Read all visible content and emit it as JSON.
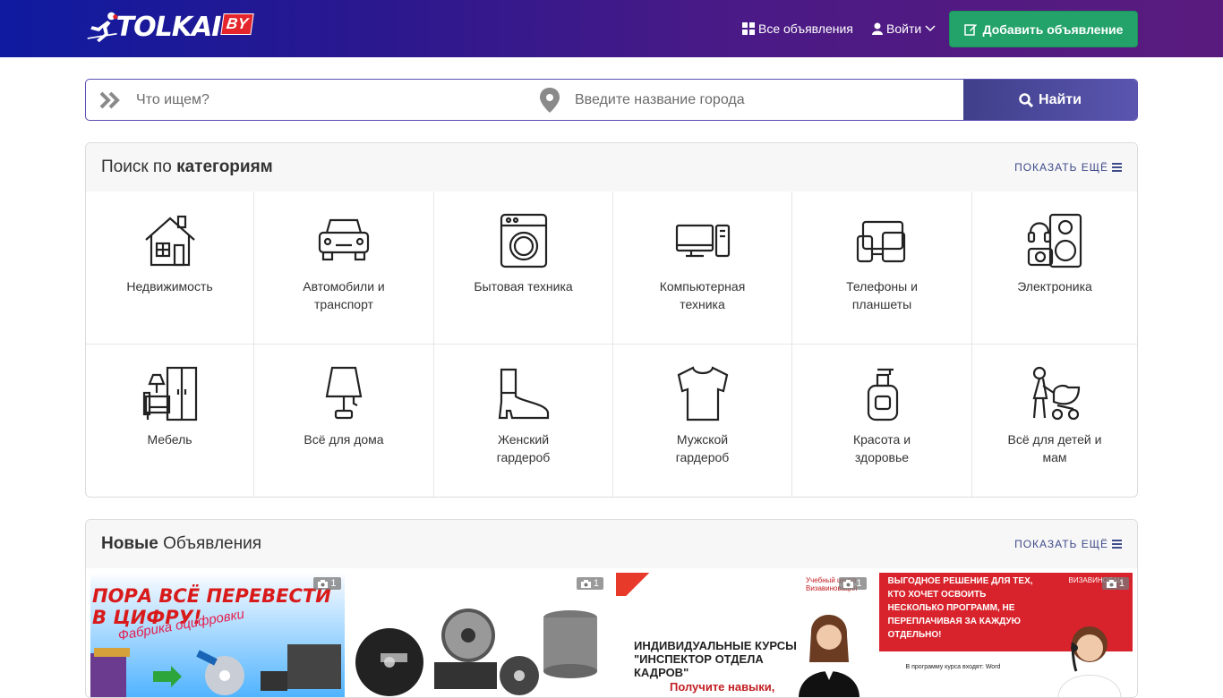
{
  "header": {
    "logo_text": "TOLKAI",
    "logo_suffix": "BY",
    "nav_all": "Все объявления",
    "nav_login": "Войти",
    "add_button": "Добавить объявление"
  },
  "search": {
    "query_placeholder": "Что ищем?",
    "city_placeholder": "Введите название города",
    "button": "Найти"
  },
  "categories": {
    "title_prefix": "Поиск по",
    "title_bold": "категориям",
    "show_more": "ПОКАЗАТЬ ЕЩЁ",
    "items": [
      {
        "label": "Недвижимость",
        "icon": "house-icon"
      },
      {
        "label": "Автомобили и транспорт",
        "icon": "car-icon"
      },
      {
        "label": "Бытовая техника",
        "icon": "washing-machine-icon"
      },
      {
        "label": "Компьютерная техника",
        "icon": "computer-icon"
      },
      {
        "label": "Телефоны и планшеты",
        "icon": "phone-tablet-icon"
      },
      {
        "label": "Электроника",
        "icon": "electronics-icon"
      },
      {
        "label": "Мебель",
        "icon": "furniture-icon"
      },
      {
        "label": "Всё для дома",
        "icon": "lamp-icon"
      },
      {
        "label": "Женский гардероб",
        "icon": "boot-icon"
      },
      {
        "label": "Мужской гардероб",
        "icon": "tshirt-icon"
      },
      {
        "label": "Красота и здоровье",
        "icon": "cosmetics-icon"
      },
      {
        "label": "Всё для детей и мам",
        "icon": "stroller-icon"
      }
    ]
  },
  "new_listings": {
    "title_bold": "Новые",
    "title_rest": "Объявления",
    "show_more": "ПОКАЗАТЬ ЕЩЁ",
    "cards": [
      {
        "photo_count": "1",
        "text": "ПОРА ВСЁ ПЕРЕВЕСТИ В ЦИФРУ!",
        "subtext": "Фабрика оцифровки"
      },
      {
        "photo_count": "1"
      },
      {
        "photo_count": "1",
        "text": "ИНДИВИДУАЛЬНЫЕ КУРСЫ \"ИНСПЕКТОР ОТДЕЛА КАДРОВ\"",
        "subtext": "Получите навыки,",
        "logo": "Учебный центр Визавиновация"
      },
      {
        "photo_count": "1",
        "text": "ВЫГОДНОЕ РЕШЕНИЕ ДЛЯ ТЕХ, КТО ХОЧЕТ ОСВОИТЬ НЕСКОЛЬКО ПРОГРАММ, НЕ ПЕРЕПЛАЧИВАЯ ЗА КАЖДУЮ ОТДЕЛЬНО!",
        "subtext": "В программу курса входят: Word",
        "logo": "ВИЗАВИНОВАЦ"
      }
    ]
  },
  "colors": {
    "header_start": "#0f1aa0",
    "header_end": "#5a1b7e",
    "add_button": "#23a36a",
    "search_button": "#4a4a9c"
  }
}
